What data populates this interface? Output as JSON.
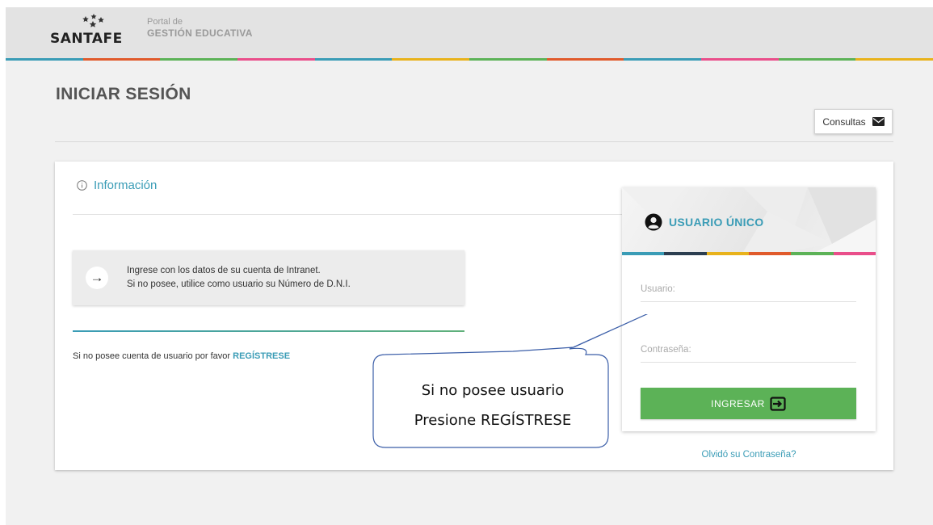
{
  "header": {
    "brand": "SANTAFE",
    "portal_small": "Portal de",
    "portal_big": "GESTIÓN EDUCATIVA",
    "stripe_colors": [
      "#3a9cb6",
      "#e05a2b",
      "#5cb257",
      "#e94e8a",
      "#3a9cb6",
      "#e8b21b",
      "#5cb257",
      "#e05a2b",
      "#3a9cb6",
      "#e94e8a",
      "#5cb257",
      "#e8b21b"
    ]
  },
  "page": {
    "title": "INICIAR SESIÓN",
    "consultas_label": "Consultas"
  },
  "info": {
    "heading": "Información",
    "line1": "Ingrese con los datos de su cuenta de Intranet.",
    "line2": "Si no posee, utilice como usuario su Número de D.N.I.",
    "register_prefix": "Si no posee cuenta de usuario por favor",
    "register_link": "REGÍSTRESE"
  },
  "login": {
    "title": "USUARIO ÚNICO",
    "usuario_placeholder": "Usuario:",
    "password_placeholder": "Contraseña:",
    "submit_label": "INGRESAR",
    "forgot_label": "Olvidó su Contraseña?",
    "stripe_colors": [
      "#3a9cb6",
      "#2c3e50",
      "#e8b21b",
      "#e05a2b",
      "#5cb257",
      "#e94e8a"
    ]
  },
  "callout": {
    "line1": "Si no posee usuario",
    "line2": "Presione REGÍSTRESE"
  },
  "colors": {
    "accent": "#3a9cb6",
    "button_green": "#5cb257"
  }
}
